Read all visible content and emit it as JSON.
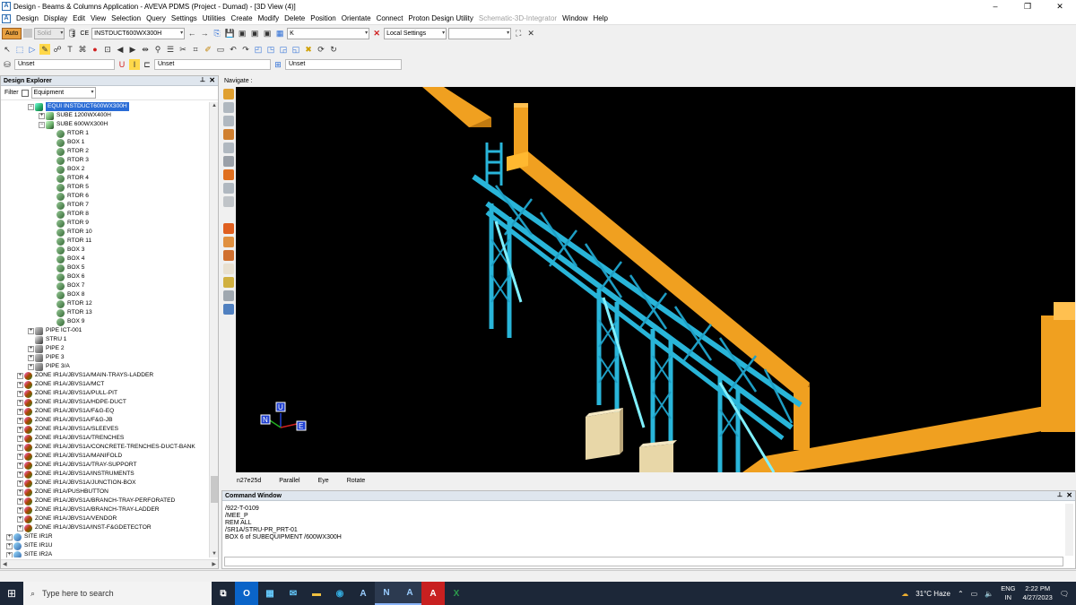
{
  "window": {
    "title": "Design - Beams & Columns Application - AVEVA PDMS (Project - Dumad) - [3D View (4)]",
    "controls": [
      "–",
      "❐",
      "✕"
    ]
  },
  "menu": [
    "Design",
    "Display",
    "Edit",
    "View",
    "Selection",
    "Query",
    "Settings",
    "Utilities",
    "Create",
    "Modify",
    "Delete",
    "Position",
    "Orientate",
    "Connect",
    "Proton Design Utility"
  ],
  "menu_dim": [
    "Schematic-3D-Integrator"
  ],
  "menu_tail": [
    "Window",
    "Help"
  ],
  "toolbar1": {
    "auto_label": "Auto",
    "solid_label": "Solid",
    "ce_label": "CE",
    "ce_value": "INSTDUCT600WX300H",
    "k_value": "K",
    "settings_value": "Local Settings"
  },
  "toolbar3": {
    "unset1": "Unset",
    "unset2": "Unset",
    "unset3": "Unset"
  },
  "explorer": {
    "title": "Design Explorer",
    "filter_label": "Filter",
    "filter_value": "Equipment",
    "items": [
      {
        "label": "EQUI INSTDUCT600WX300H",
        "depth": 2,
        "icon": "equi",
        "exp": "−",
        "selected": true
      },
      {
        "label": "SUBE 1200WX400H",
        "depth": 3,
        "icon": "sube",
        "exp": "+"
      },
      {
        "label": "SUBE 600WX300H",
        "depth": 3,
        "icon": "sube",
        "exp": "−"
      },
      {
        "label": "RTOR 1",
        "depth": 4,
        "icon": "rtor"
      },
      {
        "label": "BOX 1",
        "depth": 4,
        "icon": "rtor"
      },
      {
        "label": "RTOR 2",
        "depth": 4,
        "icon": "rtor"
      },
      {
        "label": "RTOR 3",
        "depth": 4,
        "icon": "rtor"
      },
      {
        "label": "BOX 2",
        "depth": 4,
        "icon": "rtor"
      },
      {
        "label": "RTOR 4",
        "depth": 4,
        "icon": "rtor"
      },
      {
        "label": "RTOR 5",
        "depth": 4,
        "icon": "rtor"
      },
      {
        "label": "RTOR 6",
        "depth": 4,
        "icon": "rtor"
      },
      {
        "label": "RTOR 7",
        "depth": 4,
        "icon": "rtor"
      },
      {
        "label": "RTOR 8",
        "depth": 4,
        "icon": "rtor"
      },
      {
        "label": "RTOR 9",
        "depth": 4,
        "icon": "rtor"
      },
      {
        "label": "RTOR 10",
        "depth": 4,
        "icon": "rtor"
      },
      {
        "label": "RTOR 11",
        "depth": 4,
        "icon": "rtor"
      },
      {
        "label": "BOX 3",
        "depth": 4,
        "icon": "rtor"
      },
      {
        "label": "BOX 4",
        "depth": 4,
        "icon": "rtor"
      },
      {
        "label": "BOX 5",
        "depth": 4,
        "icon": "rtor"
      },
      {
        "label": "BOX 6",
        "depth": 4,
        "icon": "rtor"
      },
      {
        "label": "BOX 7",
        "depth": 4,
        "icon": "rtor"
      },
      {
        "label": "BOX 8",
        "depth": 4,
        "icon": "rtor"
      },
      {
        "label": "RTOR 12",
        "depth": 4,
        "icon": "rtor"
      },
      {
        "label": "RTOR 13",
        "depth": 4,
        "icon": "rtor"
      },
      {
        "label": "BOX 9",
        "depth": 4,
        "icon": "rtor"
      },
      {
        "label": "PIPE ICT-001",
        "depth": 2,
        "icon": "pipe",
        "exp": "+"
      },
      {
        "label": "STRU 1",
        "depth": 2,
        "icon": "stru"
      },
      {
        "label": "PIPE 2",
        "depth": 2,
        "icon": "pipe",
        "exp": "+"
      },
      {
        "label": "PIPE 3",
        "depth": 2,
        "icon": "pipe",
        "exp": "+"
      },
      {
        "label": "PIPE 3/A",
        "depth": 2,
        "icon": "pipe",
        "exp": "+"
      },
      {
        "label": "ZONE IR1A/JBVS1A/MAIN-TRAYS-LADDER",
        "depth": 1,
        "icon": "zone",
        "exp": "+"
      },
      {
        "label": "ZONE IR1A/JBVS1A/MCT",
        "depth": 1,
        "icon": "zone",
        "exp": "+"
      },
      {
        "label": "ZONE IR1A/JBVS1A/PULL-PIT",
        "depth": 1,
        "icon": "zone",
        "exp": "+"
      },
      {
        "label": "ZONE IR1A/JBVS1A/HDPE-DUCT",
        "depth": 1,
        "icon": "zone",
        "exp": "+"
      },
      {
        "label": "ZONE IR1A/JBVS1A/F&G-EQ",
        "depth": 1,
        "icon": "zone",
        "exp": "+"
      },
      {
        "label": "ZONE IR1A/JBVS1A/F&G-JB",
        "depth": 1,
        "icon": "zone",
        "exp": "+"
      },
      {
        "label": "ZONE IR1A/JBVS1A/SLEEVES",
        "depth": 1,
        "icon": "zone",
        "exp": "+"
      },
      {
        "label": "ZONE IR1A/JBVS1A/TRENCHES",
        "depth": 1,
        "icon": "zone",
        "exp": "+"
      },
      {
        "label": "ZONE IR1A/JBVS1A/CONCRETE-TRENCHES-DUCT-BANK",
        "depth": 1,
        "icon": "zone",
        "exp": "+"
      },
      {
        "label": "ZONE IR1A/JBVS1A/MANIFOLD",
        "depth": 1,
        "icon": "zone",
        "exp": "+"
      },
      {
        "label": "ZONE IR1A/JBVS1A/TRAY-SUPPORT",
        "depth": 1,
        "icon": "zone",
        "exp": "+"
      },
      {
        "label": "ZONE IR1A/JBVS1A/INSTRUMENTS",
        "depth": 1,
        "icon": "zone",
        "exp": "+"
      },
      {
        "label": "ZONE IR1A/JBVS1A/JUNCTION-BOX",
        "depth": 1,
        "icon": "zone",
        "exp": "+"
      },
      {
        "label": "ZONE IR1A/PUSHBUTTON",
        "depth": 1,
        "icon": "zone",
        "exp": "+"
      },
      {
        "label": "ZONE IR1A/JBVS1A/BRANCH-TRAY-PERFORATED",
        "depth": 1,
        "icon": "zone",
        "exp": "+"
      },
      {
        "label": "ZONE IR1A/JBVS1A/BRANCH-TRAY-LADDER",
        "depth": 1,
        "icon": "zone",
        "exp": "+"
      },
      {
        "label": "ZONE IR1A/JBVS1A/VENDOR",
        "depth": 1,
        "icon": "zone",
        "exp": "+"
      },
      {
        "label": "ZONE IR1A/JBVS1A/INST-F&GDETECTOR",
        "depth": 1,
        "icon": "zone",
        "exp": "+"
      },
      {
        "label": "SITE IR1R",
        "depth": 0,
        "icon": "site",
        "exp": "+"
      },
      {
        "label": "SITE IR1U",
        "depth": 0,
        "icon": "site",
        "exp": "+"
      },
      {
        "label": "SITE IR2A",
        "depth": 0,
        "icon": "site",
        "exp": "+"
      }
    ]
  },
  "viewport": {
    "title": "Navigate :",
    "status": [
      "n27e25d",
      "Parallel",
      "Eye",
      "Rotate"
    ],
    "axes": {
      "up": "U",
      "north": "N",
      "east": "E"
    }
  },
  "command": {
    "title": "Command Window",
    "lines": [
      "/922-T-0109",
      "/MEE_P",
      "REM ALL",
      "/SR1A/STRU-PR_PRT-01",
      "BOX 6 of SUBEQUIPMENT /600WX300H"
    ]
  },
  "taskbar": {
    "search_placeholder": "Type here to search",
    "weather": "31°C  Haze",
    "lang_top": "ENG",
    "lang_bottom": "IN",
    "time": "2:22 PM",
    "date": "4/27/2023",
    "apps": [
      "task-view-icon",
      "outlook-icon",
      "store-icon",
      "mail-icon",
      "file-explorer-icon",
      "edge-icon",
      "aveva-a-icon",
      "aveva-n-icon",
      "aveva-a2-icon",
      "acrobat-icon",
      "excel-icon"
    ]
  },
  "colors": {
    "duct": "#f0a020",
    "steel": "#29b5d9",
    "brace": "#7ff0ff",
    "footing": "#e8d7a8",
    "select": "#2a6cd6"
  }
}
